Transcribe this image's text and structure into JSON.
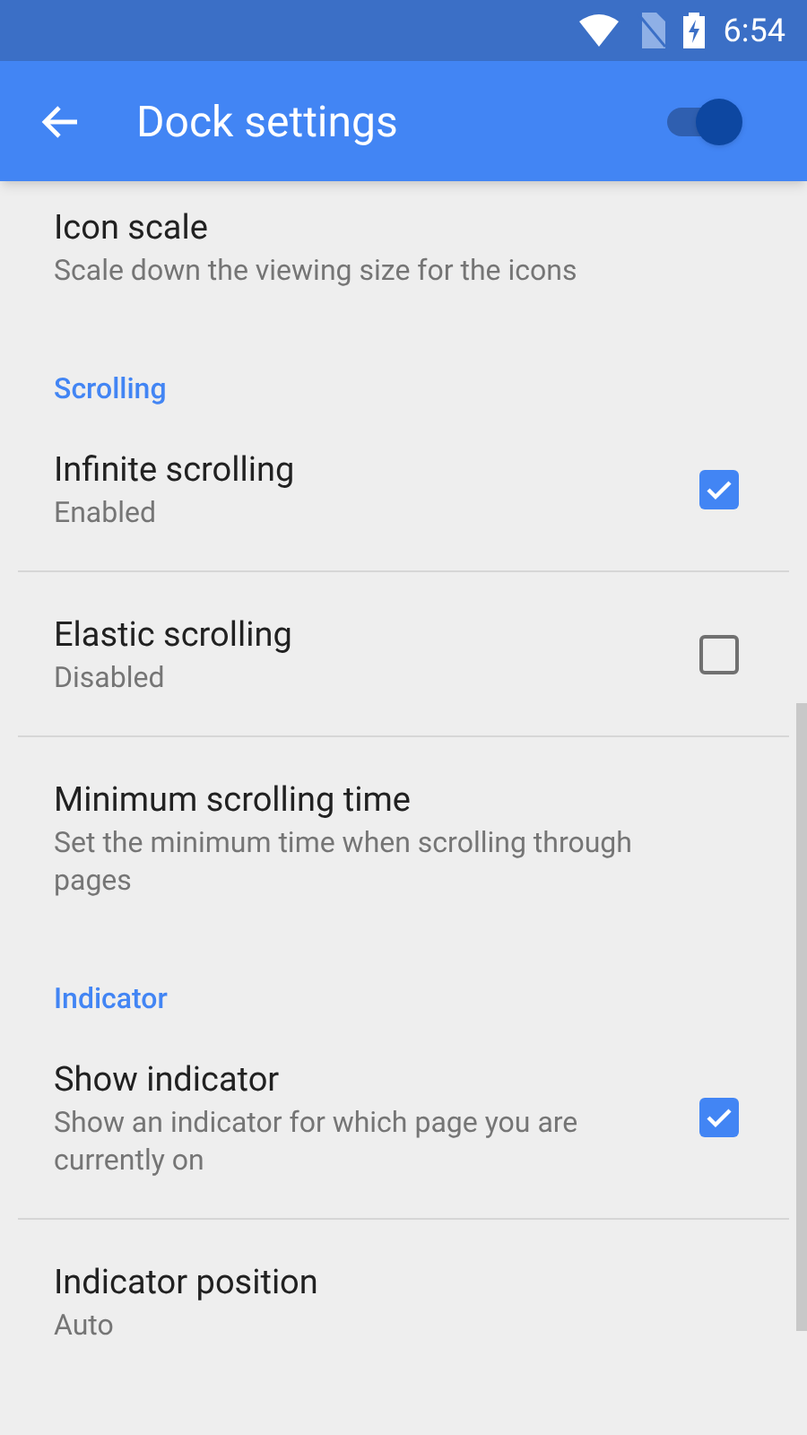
{
  "status_bar": {
    "time": "6:54"
  },
  "app_bar": {
    "title": "Dock settings",
    "master_switch": {
      "on": true
    }
  },
  "settings": [
    {
      "kind": "item",
      "title": "Icon scale",
      "summary": "Scale down the viewing size for the icons"
    },
    {
      "kind": "header",
      "title": "Scrolling"
    },
    {
      "kind": "check",
      "title": "Infinite scrolling",
      "summary": "Enabled",
      "checked": true
    },
    {
      "kind": "check",
      "title": "Elastic scrolling",
      "summary": "Disabled",
      "checked": false
    },
    {
      "kind": "item",
      "title": "Minimum scrolling time",
      "summary": "Set the minimum time when scrolling through pages"
    },
    {
      "kind": "header",
      "title": "Indicator"
    },
    {
      "kind": "check",
      "title": "Show indicator",
      "summary": "Show an indicator for which page you are currently on",
      "checked": true
    },
    {
      "kind": "item",
      "title": "Indicator position",
      "summary": "Auto"
    }
  ]
}
